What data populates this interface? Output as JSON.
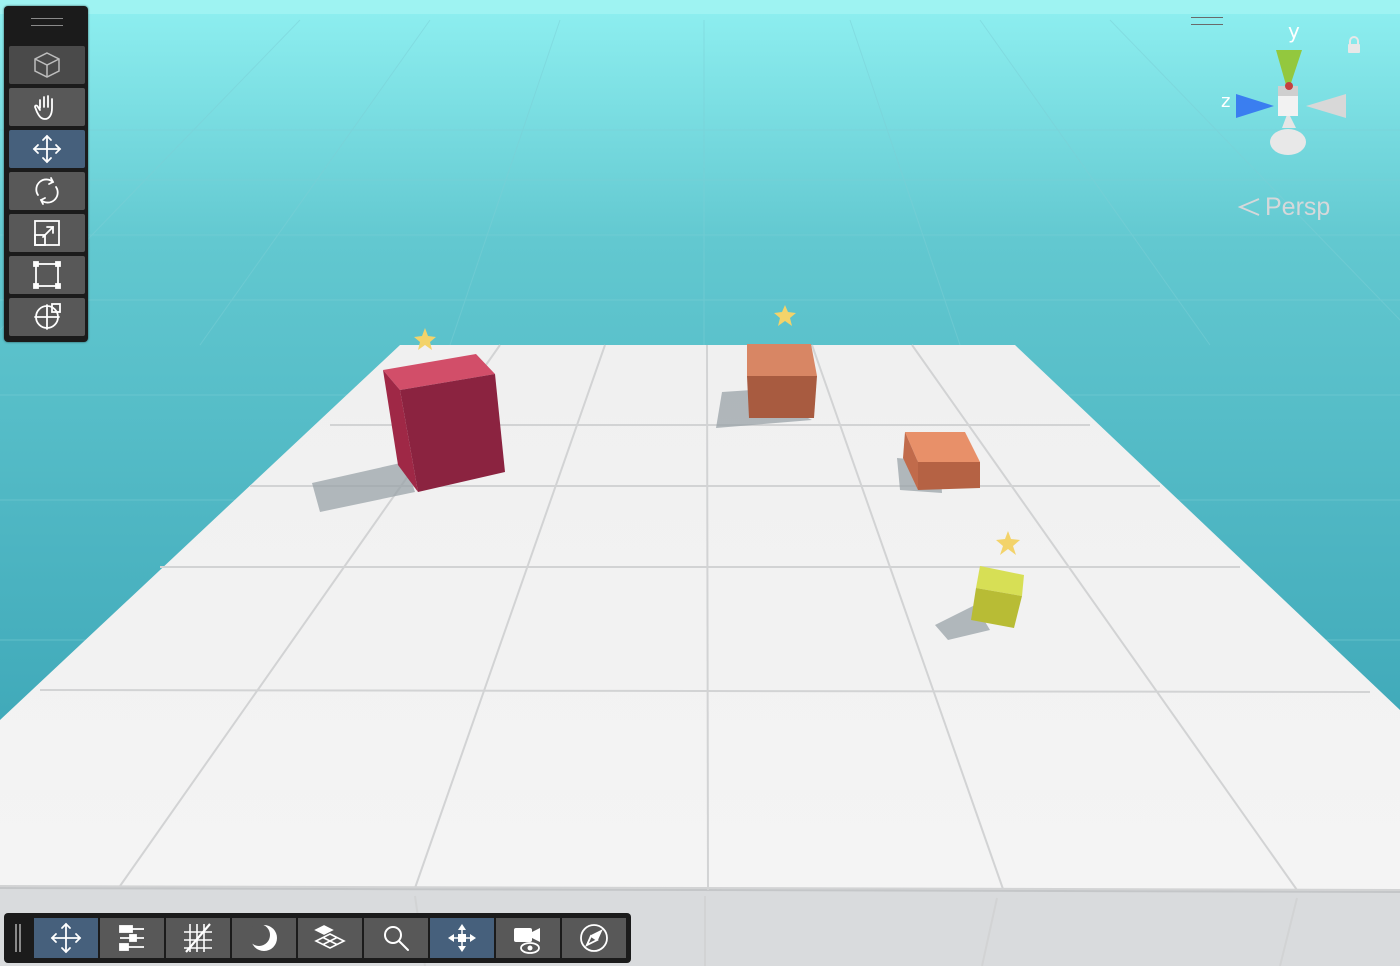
{
  "tool_panel": {
    "items": [
      {
        "id": "view",
        "icon": "cube-icon",
        "active": false
      },
      {
        "id": "hand",
        "icon": "hand-icon",
        "active": false
      },
      {
        "id": "move",
        "icon": "move-arrows-icon",
        "active": true
      },
      {
        "id": "rotate",
        "icon": "rotate-icon",
        "active": false
      },
      {
        "id": "scale",
        "icon": "scale-icon",
        "active": false
      },
      {
        "id": "rect",
        "icon": "rect-transform-icon",
        "active": false
      },
      {
        "id": "transform",
        "icon": "transform-icon",
        "active": false
      }
    ]
  },
  "bottom_toolbar": {
    "items": [
      {
        "id": "move",
        "icon": "move-arrows-icon",
        "active": true
      },
      {
        "id": "draw-mode",
        "icon": "sliders-icon",
        "active": false
      },
      {
        "id": "grid",
        "icon": "grid-snap-icon",
        "active": false
      },
      {
        "id": "lighting",
        "icon": "moon-icon",
        "active": false
      },
      {
        "id": "layers",
        "icon": "layers-icon",
        "active": false
      },
      {
        "id": "search",
        "icon": "search-icon",
        "active": false
      },
      {
        "id": "gizmos",
        "icon": "gizmo-icon",
        "active": true
      },
      {
        "id": "camera",
        "icon": "camera-visibility-icon",
        "active": false
      },
      {
        "id": "navigate",
        "icon": "compass-icon",
        "active": false
      }
    ]
  },
  "gizmo": {
    "y_label": "y",
    "z_label": "z",
    "projection": "Persp",
    "colors": {
      "y": "#93c83e",
      "z": "#3a7ef0",
      "x": "#d0d0d0"
    }
  },
  "scene": {
    "sky_top": "#8feef0",
    "sky_bottom": "#35a2b3",
    "floor": "#f2f2f2",
    "objects": [
      {
        "name": "crimson-cube",
        "color": "#b5344f"
      },
      {
        "name": "orange-box-back",
        "color": "#c97255"
      },
      {
        "name": "orange-box-right",
        "color": "#e2865f"
      },
      {
        "name": "yellow-cube",
        "color": "#c8cf3c"
      }
    ],
    "star_color": "#f3d36a"
  }
}
